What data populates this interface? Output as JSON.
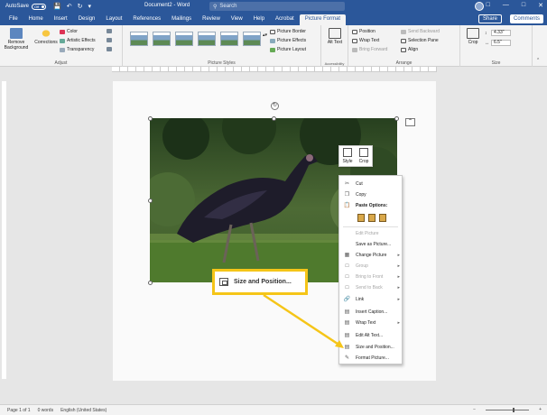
{
  "titlebar": {
    "autosave": "AutoSave",
    "toggle": "Off",
    "doc_title": "Document2 - Word",
    "search_placeholder": "Search"
  },
  "tabs": [
    "File",
    "Home",
    "Insert",
    "Design",
    "Layout",
    "References",
    "Mailings",
    "Review",
    "View",
    "Help",
    "Acrobat",
    "Picture Format"
  ],
  "active_tab": "Picture Format",
  "share_label": "Share",
  "comments_label": "Comments",
  "ribbon": {
    "remove_background": "Remove Background",
    "corrections": "Corrections",
    "color": "Color",
    "artistic_effects": "Artistic Effects",
    "transparency": "Transparency",
    "adjust": "Adjust",
    "picture_styles": "Picture Styles",
    "picture_border": "Picture Border",
    "picture_effects": "Picture Effects",
    "picture_layout": "Picture Layout",
    "alt_text": "Alt Text",
    "accessibility": "Accessibility",
    "position": "Position",
    "wrap_text": "Wrap Text",
    "bring_forward": "Bring Forward",
    "send_backward": "Send Backward",
    "selection_pane": "Selection Pane",
    "align": "Align",
    "arrange": "Arrange",
    "crop": "Crop",
    "height": "4.33\"",
    "width": "6.5\"",
    "size": "Size"
  },
  "mini_toolbar": {
    "style": "Style",
    "crop": "Crop"
  },
  "context_menu": {
    "cut": "Cut",
    "copy": "Copy",
    "paste_options": "Paste Options:",
    "edit_picture": "Edit Picture",
    "save_as_picture": "Save as Picture...",
    "change_picture": "Change Picture",
    "group": "Group",
    "bring_to_front": "Bring to Front",
    "send_to_back": "Send to Back",
    "link": "Link",
    "insert_caption": "Insert Caption...",
    "wrap_text": "Wrap Text",
    "edit_alt_text": "Edit Alt Text...",
    "size_and_position": "Size and Position...",
    "format_picture": "Format Picture..."
  },
  "callout_label": "Size and Position...",
  "statusbar": {
    "page": "Page 1 of 1",
    "words": "0 words",
    "language": "English (United States)"
  },
  "colors": {
    "word_blue": "#2b579a",
    "callout_yellow": "#f5c518"
  }
}
